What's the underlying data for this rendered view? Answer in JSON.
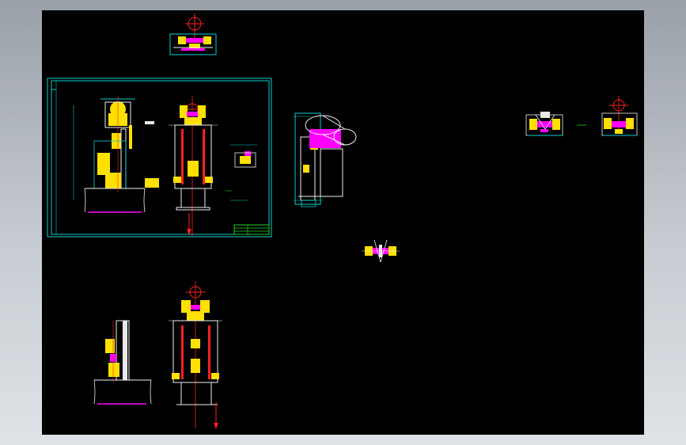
{
  "viewer": {
    "background_color": "#000000",
    "frame_color": "#b4bac1"
  },
  "colors": {
    "cyan": "#00d0d0",
    "yellow": "#ffe000",
    "magenta": "#ff00ff",
    "red": "#ff2020",
    "white": "#f0f0f0",
    "green": "#20d020"
  },
  "drawing_views": [
    {
      "name": "top-wheel-detail"
    },
    {
      "name": "title-sheet-frame"
    },
    {
      "name": "side-view-sheet"
    },
    {
      "name": "front-view-sheet"
    },
    {
      "name": "part-detail-sheet"
    },
    {
      "name": "motor-drive-view"
    },
    {
      "name": "right-wheel-detail-a"
    },
    {
      "name": "right-wheel-detail-b"
    },
    {
      "name": "center-roller-detail"
    },
    {
      "name": "bottom-side-view"
    },
    {
      "name": "bottom-front-view"
    }
  ]
}
